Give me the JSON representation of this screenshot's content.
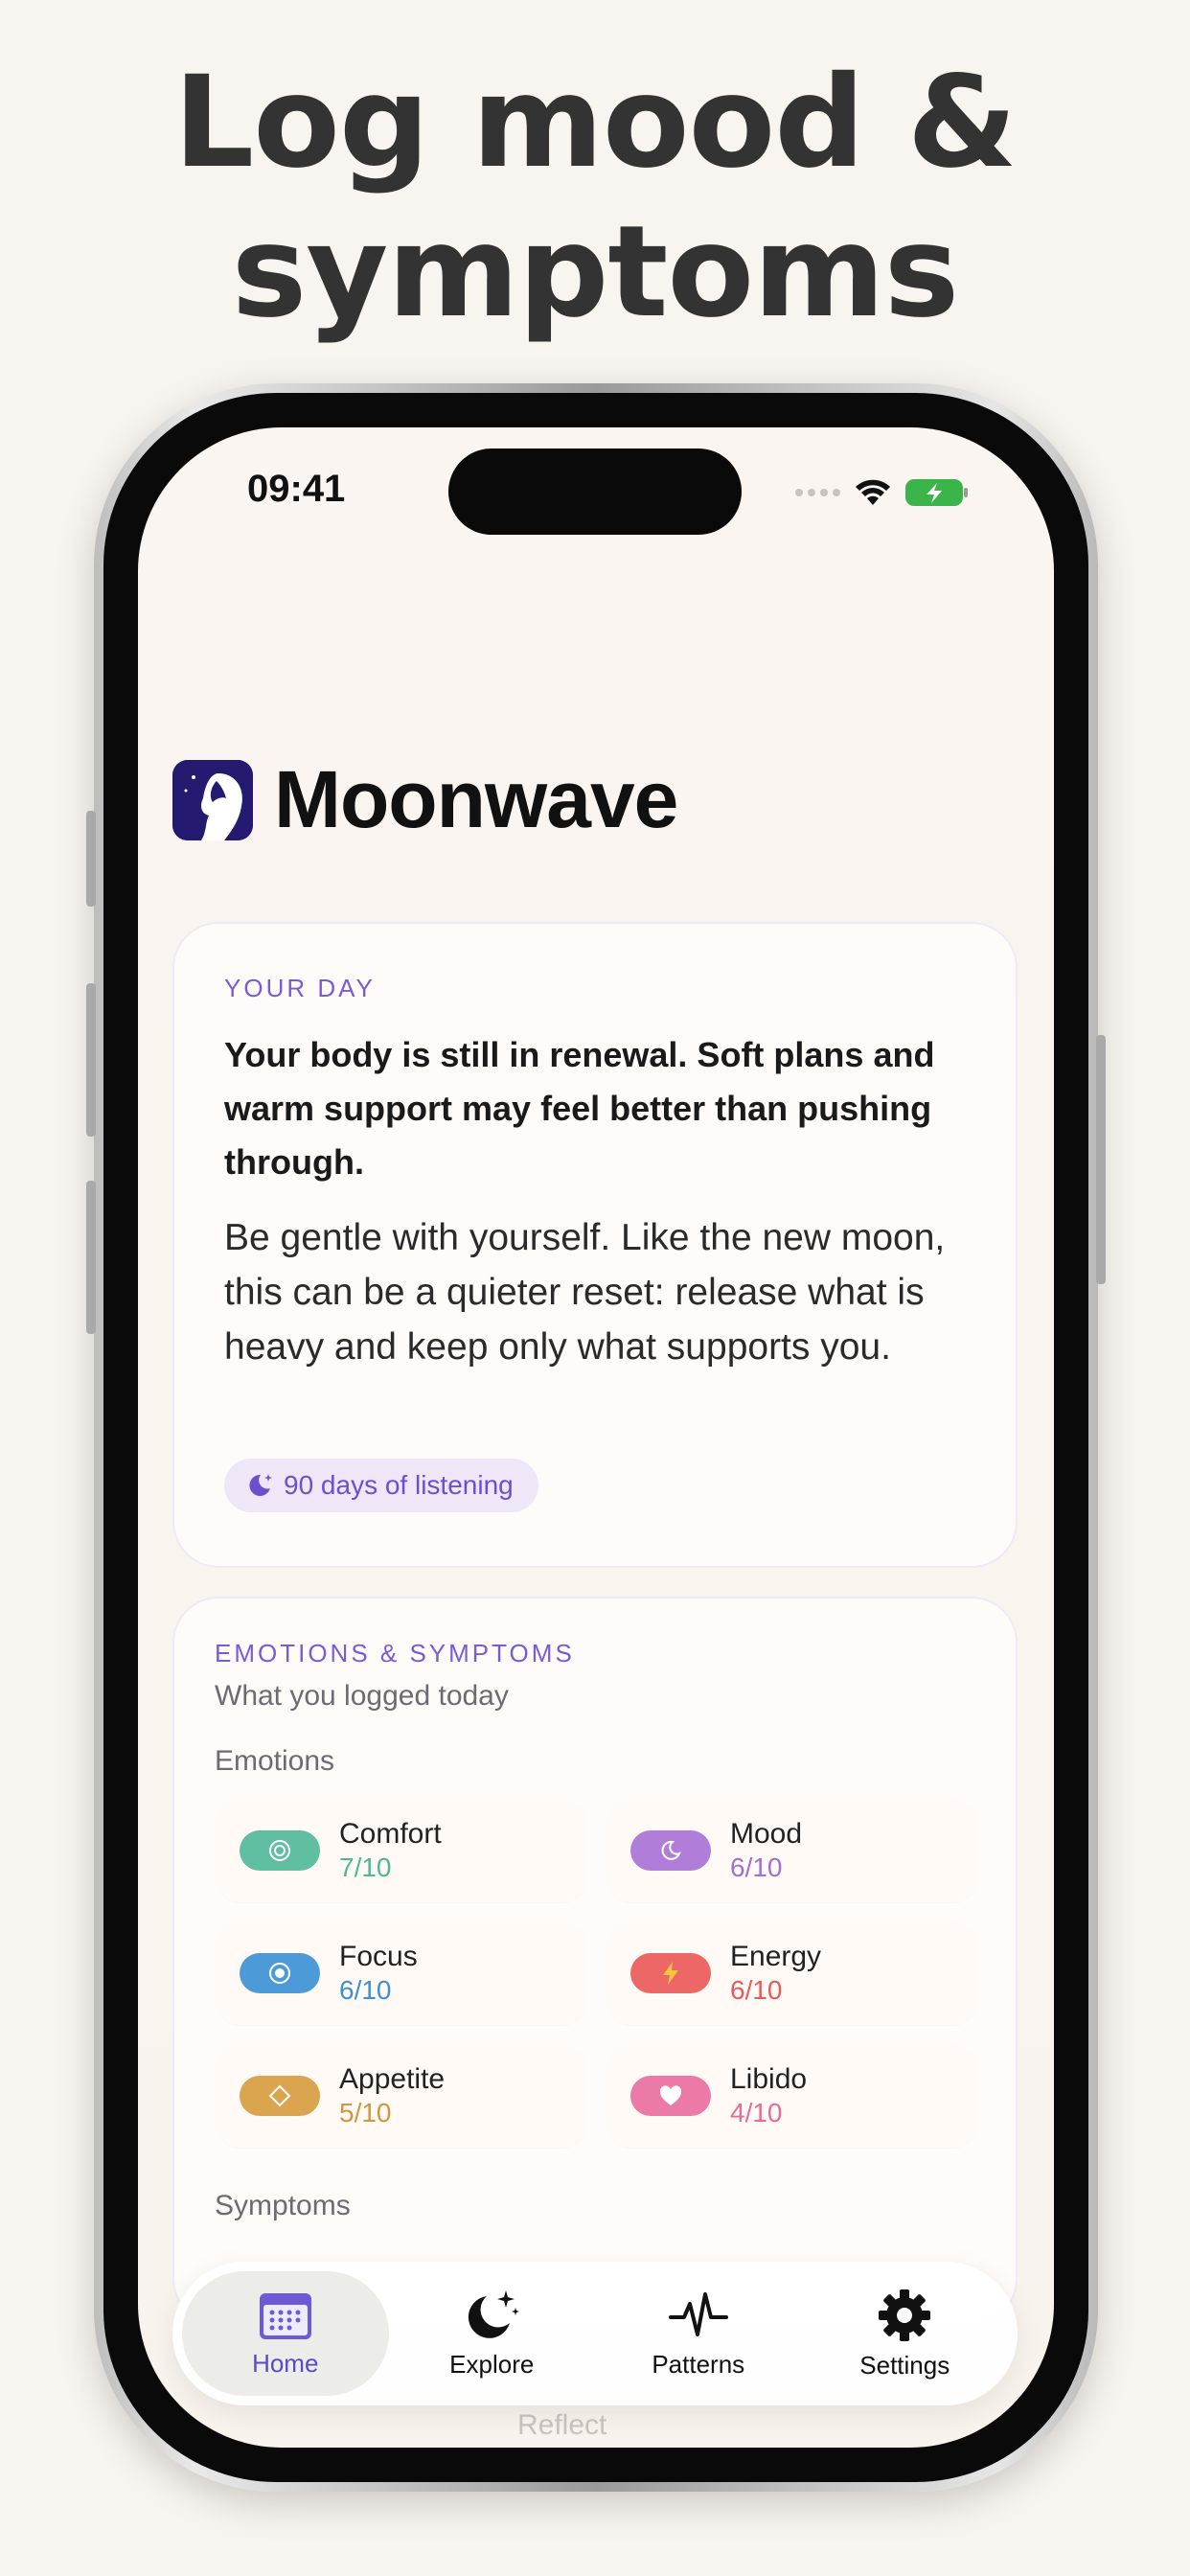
{
  "headline": {
    "line1": "Log mood &",
    "line2": "symptoms"
  },
  "status_bar": {
    "time": "09:41"
  },
  "app": {
    "name": "Moonwave"
  },
  "day_card": {
    "kicker": "YOUR DAY",
    "headline": "Your body is still in renewal. Soft plans and warm support may feel better than pushing through.",
    "body": "Be gentle with yourself. Like the new moon, this can be a quieter reset: release what is heavy and keep only what supports you.",
    "badge": "90 days of listening"
  },
  "emotions_card": {
    "kicker": "EMOTIONS & SYMPTOMS",
    "subtitle": "What you logged today",
    "emotions_label": "Emotions",
    "symptoms_label": "Symptoms",
    "items": [
      {
        "name": "Comfort",
        "score": "7/10",
        "color": "#5fbfa0",
        "icon": "ring-icon"
      },
      {
        "name": "Mood",
        "score": "6/10",
        "color": "#b07ed8",
        "icon": "moon-icon"
      },
      {
        "name": "Focus",
        "score": "6/10",
        "color": "#4d9ad9",
        "icon": "target-icon"
      },
      {
        "name": "Energy",
        "score": "6/10",
        "color": "#ee6767",
        "icon": "bolt-icon"
      },
      {
        "name": "Appetite",
        "score": "5/10",
        "color": "#dba44f",
        "icon": "diamond-icon"
      },
      {
        "name": "Libido",
        "score": "4/10",
        "color": "#ec7aa6",
        "icon": "heart-icon"
      }
    ]
  },
  "tab_bar": {
    "tabs": [
      {
        "label": "Home",
        "icon": "calendar-icon",
        "active": true
      },
      {
        "label": "Explore",
        "icon": "moon-stars-icon",
        "active": false
      },
      {
        "label": "Patterns",
        "icon": "pulse-icon",
        "active": false
      },
      {
        "label": "Settings",
        "icon": "gear-icon",
        "active": false
      }
    ]
  },
  "ghost_label": "Reflect",
  "colors": {
    "accent": "#7a5bd6",
    "background": "#f8f4ef"
  }
}
